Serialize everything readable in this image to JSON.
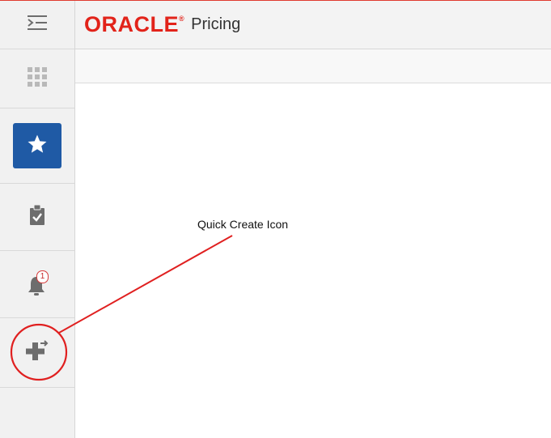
{
  "header": {
    "logo_text": "ORACLE",
    "logo_mark": "®",
    "app_title": "Pricing"
  },
  "rail": {
    "items": [
      {
        "icon": "menu-toggle-icon"
      },
      {
        "icon": "apps-grid-icon"
      },
      {
        "icon": "favorites-star-icon",
        "active": true
      },
      {
        "icon": "tasks-clipboard-icon"
      },
      {
        "icon": "notifications-bell-icon",
        "badge": "1"
      },
      {
        "icon": "quick-create-icon"
      }
    ]
  },
  "annotation": {
    "label": "Quick Create Icon"
  },
  "colors": {
    "brand": "#e2231a",
    "favorites_active": "#1f5aa5",
    "icon_gray": "#6d6d6d",
    "annotation_red": "#e02020"
  }
}
